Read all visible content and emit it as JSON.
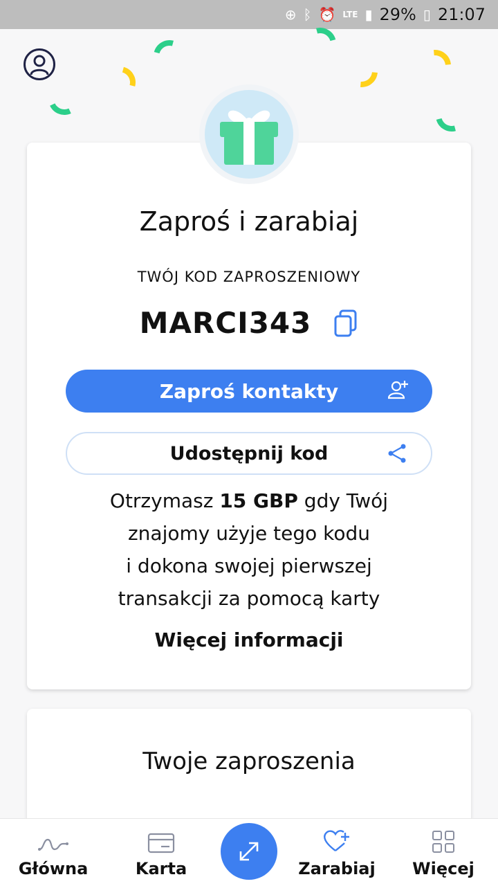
{
  "status_bar": {
    "battery": "29%",
    "time": "21:07",
    "network": "LTE"
  },
  "colors": {
    "accent": "#3d7ff0",
    "confetti_yellow": "#ffd11a",
    "confetti_green": "#2ccf8a"
  },
  "referral": {
    "title": "Zaproś i zarabiaj",
    "code_label": "TWÓJ KOD ZAPROSZENIOWY",
    "code": "MARCI343",
    "invite_button": "Zaproś kontakty",
    "share_button": "Udostępnij kod",
    "desc_prefix": "Otrzymasz ",
    "desc_amount": "15 GBP",
    "desc_line1_suffix": " gdy Twój",
    "desc_line2": "znajomy użyje tego kodu",
    "desc_line3": "i dokona swojej pierwszej",
    "desc_line4": "transakcji za pomocą karty",
    "more_info": "Więcej informacji"
  },
  "invitations": {
    "title": "Twoje zaproszenia"
  },
  "bottom_nav": {
    "home": "Główna",
    "card": "Karta",
    "earn": "Zarabiaj",
    "more": "Więcej"
  }
}
